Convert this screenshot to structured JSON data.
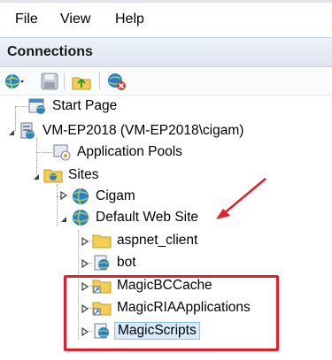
{
  "menu": {
    "items": [
      "File",
      "View",
      "Help"
    ]
  },
  "panel": {
    "title": "Connections"
  },
  "toolbar": {
    "buttons": [
      "connect-icon",
      "save-icon",
      "folder-up-icon",
      "disconnect-icon"
    ]
  },
  "tree": {
    "start_page": "Start Page",
    "server": "VM-EP2018 (VM-EP2018\\cigam)",
    "app_pools": "Application Pools",
    "sites": "Sites",
    "cigam": "Cigam",
    "default_site": "Default Web Site",
    "children": [
      "aspnet_client",
      "bot",
      "MagicBCCache",
      "MagicRIAApplications",
      "MagicScripts"
    ]
  },
  "colors": {
    "annotation": "#e0202a",
    "selection": "#d9ebfb"
  }
}
